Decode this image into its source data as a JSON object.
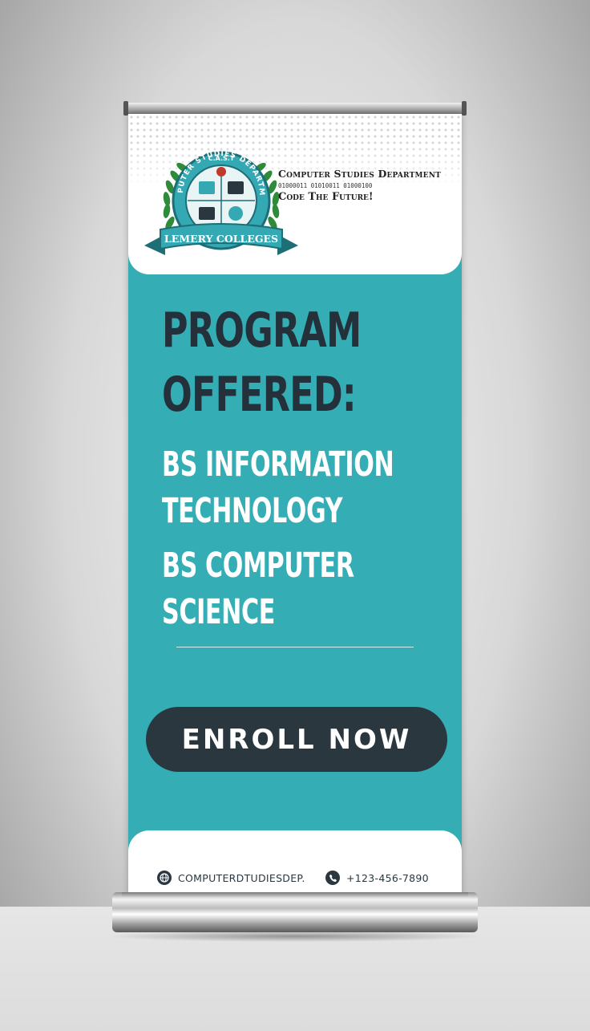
{
  "logo": {
    "ring_text": "COMPUTER STUDIES DEPARTMENT",
    "top_text": "C.A.S.T",
    "ribbon_text": "LEMERY COLLEGES"
  },
  "header": {
    "department": "Computer Studies Department",
    "binary": "01000011 01010011 01000100",
    "slogan": "Code The Future!"
  },
  "main": {
    "heading_line1": "PROGRAM",
    "heading_line2": "OFFERED:",
    "programs": [
      {
        "line1": "BS INFORMATION",
        "line2": "TECHNOLOGY"
      },
      {
        "line1": "BS COMPUTER",
        "line2": "SCIENCE"
      }
    ],
    "cta_label": "ENROLL NOW"
  },
  "footer": {
    "website": "COMPUTERDTUDIESDEP.",
    "phone": "+123-456-7890"
  },
  "colors": {
    "teal": "#35adb5",
    "dark": "#24313b",
    "button": "#2a373f",
    "white": "#ffffff",
    "logo_green": "#2e8b3a"
  },
  "icons": [
    "globe-icon",
    "phone-icon"
  ]
}
